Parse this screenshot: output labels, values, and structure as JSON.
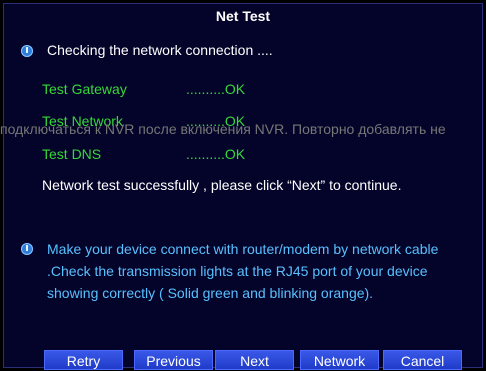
{
  "title": "Net Test",
  "checking": "Checking the network connection ....",
  "tests": [
    {
      "label": "Test Gateway",
      "status": "..........OK"
    },
    {
      "label": "Test Network",
      "status": "..........OK"
    },
    {
      "label": "Test DNS",
      "status": "..........OK"
    }
  ],
  "success_message": "Network test successfully , please click “Next” to continue.",
  "hint_lines": [
    "Make your device connect with router/modem by network cable",
    ".Check the transmission lights at the RJ45 port of your device",
    "showing correctly ( Solid green and blinking orange)."
  ],
  "overlay_text": "подключаться к NVR после включения NVR. Повторно добавлять не",
  "buttons": [
    "Retry",
    "Previous",
    "Next",
    "Network",
    "Cancel"
  ],
  "icons": {
    "info": "info-icon"
  }
}
